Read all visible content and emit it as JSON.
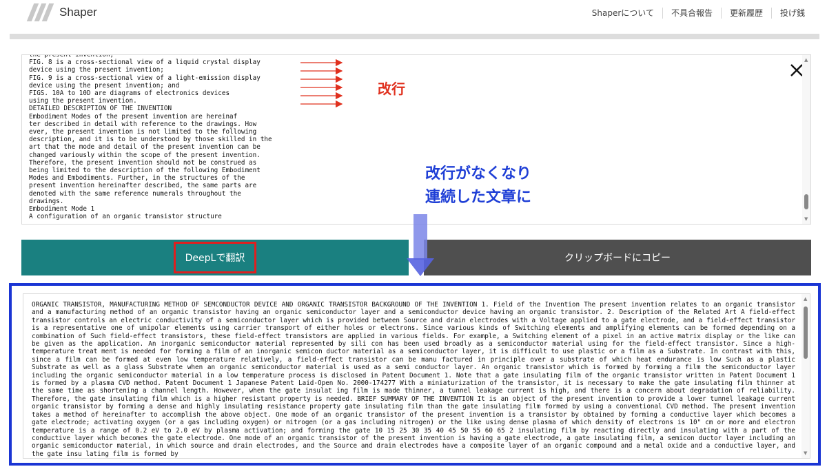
{
  "header": {
    "logo_text": "Shaper",
    "nav": [
      "Shaperについて",
      "不具合報告",
      "更新履歴",
      "投げ銭"
    ]
  },
  "source": {
    "text": "the present invention;\nFIG. 8 is a cross-sectional view of a liquid crystal display\ndevice using the present invention;\nFIG. 9 is a cross-sectional view of a light-emission display\ndevice using the present invention; and\nFIGS. 10A to 10D are diagrams of electronics devices\nusing the present invention.\nDETAILED DESCRIPTION OF THE INVENTION\nEmbodiment Modes of the present invention are hereinaf\nter described in detail with reference to the drawings. How\never, the present invention is not limited to the following\ndescription, and it is to be understood by those skilled in the\nart that the mode and detail of the present invention can be\nchanged variously within the scope of the present invention.\nTherefore, the present invention should not be construed as\nbeing limited to the description of the following Embodiment\nModes and Embodiments. Further, in the structures of the\npresent invention hereinafter described, the same parts are\ndenoted with the same reference numerals throughout the\ndrawings.\nEmbodiment Mode 1\nA configuration of an organic transistor structure"
  },
  "annotations": {
    "line_break": "改行",
    "result_line1": "改行がなくなり",
    "result_line2": "連続した文章に",
    "accent_red": "#e0301e",
    "accent_blue": "#1f3fd6"
  },
  "buttons": {
    "translate": "DeepLで翻訳",
    "copy": "クリップボードにコピー"
  },
  "output": {
    "text": "ORGANIC TRANSISTOR, MANUFACTURING METHOD OF SEMCONDUCTOR DEVICE AND ORGANIC TRANSISTOR BACKGROUND OF THE INVENTION 1. Field of the Invention The present invention relates to an organic transistor and a manufacturing method of an organic transistor having an organic semiconductor layer and a semiconductor device having an organic transistor. 2. Description of the Related Art A field-effect transistor controls an electric conductivity of a semiconductor layer which is provided between Source and drain electrodes with a Voltage applied to a gate electrode, and a field-effect transistor is a representative one of unipolar elements using carrier transport of either holes or electrons. Since various kinds of Switching elements and amplifying elements can be formed depending on a combination of Such field-effect transistors, these field-effect transistors are applied in various fields. For example, a Switching element of a pixel in an active matrix display or the like can be given as the application. An inorganic semiconductor material represented by sili con has been used broadly as a semiconductor material using for the field-effect transistor. Since a high-temperature treat ment is needed for forming a film of an inorganic semicon ductor material as a semiconductor layer, it is difficult to use plastic or a film as a Substrate. In contrast with this, since a film can be formed at even low temperature relatively, a field-effect transistor can be manu factured in principle over a substrate of which heat endurance is low Such as a plastic Substrate as well as a glass Substrate when an organic semiconductor material is used as a semi conductor layer. An organic transistor which is formed by forming a film the semiconductor layer including the organic semiconductor material in a low temperature process is disclosed in Patent Document 1. Note that a gate insulating film of the organic transistor written in Patent Document 1 is formed by a plasma CVD method. Patent Document 1 Japanese Patent Laid-Open No. 2000-174277 With a miniaturization of the transistor, it is necessary to make the gate insulating film thinner at the same time as shortening a channel length. However, when the gate insulat ing film is made thinner, a tunnel leakage current is high, and there is a concern about degradation of reliability. Therefore, the gate insulating film which is a higher resistant property is needed. BRIEF SUMMARY OF THE INVENTION It is an object of the present invention to provide a lower tunnel leakage current organic transistor by forming a dense and highly insulating resistance property gate insulating film than the gate insulating film formed by using a conventional CVD method. The present invention takes a method of hereinafter to accomplish the above object. One mode of an organic transistor of the present invention is a transistor by obtained by forming a conductive layer which becomes a gate electrode; activating oxygen (or a gas including oxygen) or nitrogen (or a gas including nitrogen) or the like using dense plasma of which density of electrons is 10\" cm or more and electron temperature is a range of 0.2 eV to 2.0 eV by plasma activation; and forming the gate 10 15 25 30 35 40 45 50 55 60 65 2 insulating film by reacting directly and insulating with a part of the conductive layer which becomes the gate electrode. One mode of an organic transistor of the present invention is having a gate electrode, a gate insulating film, a semicon ductor layer including an organic semiconductor material, in which source and drain electrodes, and the Source and drain electrodes have a composite layer of an organic compound and a metal oxide and a conductive layer, and the gate insu lating film is formed by"
  }
}
